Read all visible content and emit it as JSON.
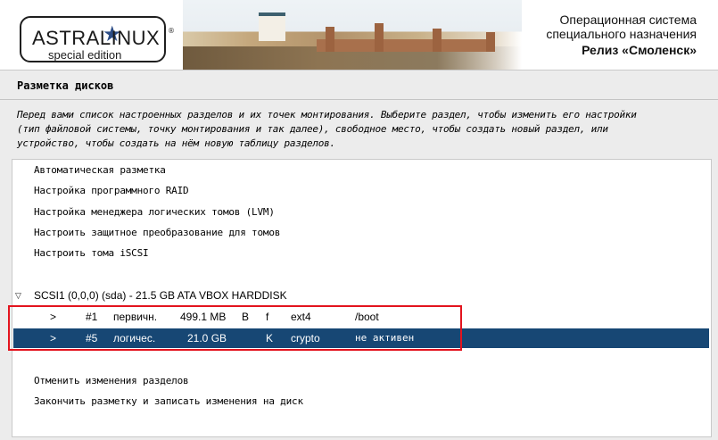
{
  "header": {
    "logo_text": "ASTRALINUX",
    "logo_subtitle": "special edition",
    "logo_registered": "®",
    "star_icon": "star-icon",
    "os_line1": "Операционная система",
    "os_line2": "специального назначения",
    "release": "Релиз «Смоленск»"
  },
  "page": {
    "title": "Разметка дисков",
    "description_line1": "Перед вами список настроенных разделов и их точек монтирования. Выберите раздел, чтобы изменить его настройки",
    "description_line2": "(тип файловой системы, точку монтирования и так далее), свободное место, чтобы создать новый раздел, или",
    "description_line3": "устройство, чтобы создать на нём новую таблицу разделов."
  },
  "menu": {
    "auto": "Автоматическая разметка",
    "raid": "Настройка программного RAID",
    "lvm": "Настройка менеджера логических томов (LVM)",
    "crypto": "Настроить защитное преобразование для томов",
    "iscsi": "Настроить тома iSCSI"
  },
  "disk": {
    "expand_icon": "triangle-down-icon",
    "label": "SCSI1 (0,0,0) (sda) - 21.5 GB ATA VBOX HARDDISK"
  },
  "partitions": [
    {
      "arrow": ">",
      "number": "#1",
      "type": "первичн.",
      "size": "499.1 MB",
      "flag_b": "B",
      "flag_f": "f",
      "fs": "ext4",
      "mount": "/boot"
    },
    {
      "arrow": ">",
      "number": "#5",
      "type": "логичес.",
      "size": "21.0 GB",
      "flag_b": "",
      "flag_f": "K",
      "fs": "crypto",
      "mount": "не активен"
    }
  ],
  "actions": {
    "undo": "Отменить изменения разделов",
    "finish": "Закончить разметку и записать изменения на диск"
  },
  "colors": {
    "selection": "#174774",
    "highlight_box": "#e3141e",
    "logo_star": "#2b4c86"
  }
}
